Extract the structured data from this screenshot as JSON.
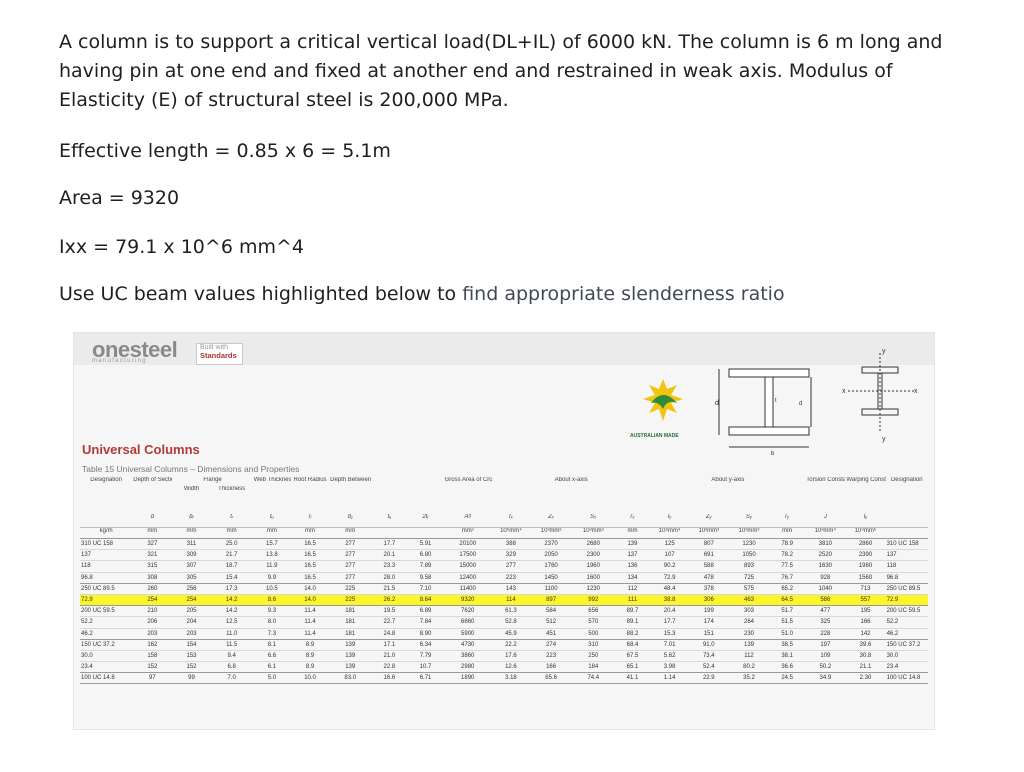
{
  "question": {
    "line1": "A column is to support a critical vertical load(DL+IL) of 6000 kN. The column is 6 m long and having pin at one end and fixed at another end and restrained in weak axis. Modulus of Elasticity (E) of structural steel is 200,000 MPa.",
    "effective_length": "Effective length = 0.85 x 6 = 5.1m",
    "area": "Area = 9320",
    "ixx": "Ixx = 79.1 x 10^6 mm^4",
    "instruction_prefix": "Use UC beam values highlighted below to ",
    "instruction_suffix": "find appropriate slenderness ratio"
  },
  "sheet": {
    "logo": "onesteel",
    "logo_sub": "manufacturing",
    "badge_top": "Built with",
    "badge_bottom": "Standards",
    "flag_label": "AUSTRALIAN MADE",
    "title": "Universal Columns",
    "subtitle": "Table 15 Universal Columns – Dimensions and Properties",
    "accent_color": "#b03a3a",
    "highlight_color": "#fbf52a"
  },
  "table": {
    "group_headers": {
      "designation": "Designation",
      "depth": "Depth of Section",
      "flange": "Flange",
      "web": "Web Thickness",
      "root": "Root Radius",
      "depth_between": "Depth Between Flanges",
      "gross": "Gross Area of Cross Section",
      "x_axis": "About x-axis",
      "y_axis": "About y-axis",
      "torsion": "Torsion Constant",
      "warping": "Warping Constant",
      "designation_r": "Designation",
      "width": "Width",
      "thickness": "Thickness"
    },
    "symbols": [
      "",
      "d",
      "bᵣ",
      "tᵣ",
      "tᵤ",
      "rᵢ",
      "d₁",
      "tᵤ",
      "2tᵣ",
      "Aᵍ",
      "Iₓ",
      "Zₓ",
      "Sₓ",
      "rₓ",
      "Iᵧ",
      "Zᵧ",
      "Sᵧ",
      "rᵧ",
      "J",
      "Iᵤ",
      ""
    ],
    "units": [
      "kg/m",
      "mm",
      "mm",
      "mm",
      "mm",
      "mm",
      "mm",
      "",
      "",
      "mm²",
      "10⁶mm⁴",
      "10³mm³",
      "10³mm³",
      "mm",
      "10⁶mm⁴",
      "10³mm³",
      "10³mm³",
      "mm",
      "10³mm⁴",
      "10⁹mm⁶",
      ""
    ],
    "rows": [
      [
        "310 UC 158",
        "327",
        "311",
        "25.0",
        "15.7",
        "16.5",
        "277",
        "17.7",
        "5.91",
        "20100",
        "388",
        "2370",
        "2680",
        "139",
        "125",
        "807",
        "1230",
        "78.9",
        "3810",
        "2860",
        "310 UC 158"
      ],
      [
        "137",
        "321",
        "309",
        "21.7",
        "13.8",
        "16.5",
        "277",
        "20.1",
        "6.80",
        "17500",
        "329",
        "2050",
        "2300",
        "137",
        "107",
        "691",
        "1050",
        "78.2",
        "2520",
        "2390",
        "137"
      ],
      [
        "118",
        "315",
        "307",
        "18.7",
        "11.9",
        "16.5",
        "277",
        "23.3",
        "7.89",
        "15000",
        "277",
        "1760",
        "1960",
        "136",
        "90.2",
        "588",
        "893",
        "77.5",
        "1630",
        "1980",
        "118"
      ],
      [
        "96.8",
        "308",
        "305",
        "15.4",
        "9.9",
        "16.5",
        "277",
        "28.0",
        "9.58",
        "12400",
        "223",
        "1450",
        "1600",
        "134",
        "72.9",
        "478",
        "725",
        "76.7",
        "928",
        "1560",
        "96.8"
      ],
      [
        "250 UC 89.5",
        "260",
        "256",
        "17.3",
        "10.5",
        "14.0",
        "225",
        "21.5",
        "7.10",
        "11400",
        "143",
        "1100",
        "1230",
        "112",
        "48.4",
        "378",
        "575",
        "65.2",
        "1040",
        "713",
        "250 UC 89.5"
      ],
      [
        "72.9",
        "254",
        "254",
        "14.2",
        "8.6",
        "14.0",
        "225",
        "26.2",
        "8.64",
        "9320",
        "114",
        "897",
        "992",
        "111",
        "38.8",
        "306",
        "463",
        "64.5",
        "586",
        "557",
        "72.9"
      ],
      [
        "200 UC 59.5",
        "210",
        "205",
        "14.2",
        "9.3",
        "11.4",
        "181",
        "19.5",
        "6.89",
        "7620",
        "61.3",
        "584",
        "656",
        "89.7",
        "20.4",
        "199",
        "303",
        "51.7",
        "477",
        "195",
        "200 UC 59.5"
      ],
      [
        "52.2",
        "206",
        "204",
        "12.5",
        "8.0",
        "11.4",
        "181",
        "22.7",
        "7.84",
        "6660",
        "52.8",
        "512",
        "570",
        "89.1",
        "17.7",
        "174",
        "264",
        "51.5",
        "325",
        "166",
        "52.2"
      ],
      [
        "46.2",
        "203",
        "203",
        "11.0",
        "7.3",
        "11.4",
        "181",
        "24.8",
        "8.90",
        "5900",
        "45.9",
        "451",
        "500",
        "88.2",
        "15.3",
        "151",
        "230",
        "51.0",
        "228",
        "142",
        "46.2"
      ],
      [
        "150 UC 37.2",
        "162",
        "154",
        "11.5",
        "8.1",
        "8.9",
        "139",
        "17.1",
        "6.34",
        "4730",
        "22.2",
        "274",
        "310",
        "68.4",
        "7.01",
        "91.0",
        "139",
        "38.5",
        "197",
        "39.6",
        "150 UC 37.2"
      ],
      [
        "30.0",
        "158",
        "153",
        "9.4",
        "6.6",
        "8.9",
        "139",
        "21.0",
        "7.79",
        "3860",
        "17.6",
        "223",
        "250",
        "67.5",
        "5.62",
        "73.4",
        "112",
        "38.1",
        "109",
        "30.8",
        "30.0"
      ],
      [
        "23.4",
        "152",
        "152",
        "6.8",
        "6.1",
        "8.9",
        "139",
        "22.8",
        "10.7",
        "2980",
        "12.6",
        "166",
        "184",
        "65.1",
        "3.98",
        "52.4",
        "80.2",
        "36.6",
        "50.2",
        "21.1",
        "23.4"
      ],
      [
        "100 UC 14.8",
        "97",
        "99",
        "7.0",
        "5.0",
        "10.0",
        "83.0",
        "16.6",
        "6.71",
        "1890",
        "3.18",
        "65.6",
        "74.4",
        "41.1",
        "1.14",
        "22.9",
        "35.2",
        "24.5",
        "34.9",
        "2.30",
        "100 UC 14.8"
      ]
    ],
    "highlighted_row_index": 5
  }
}
